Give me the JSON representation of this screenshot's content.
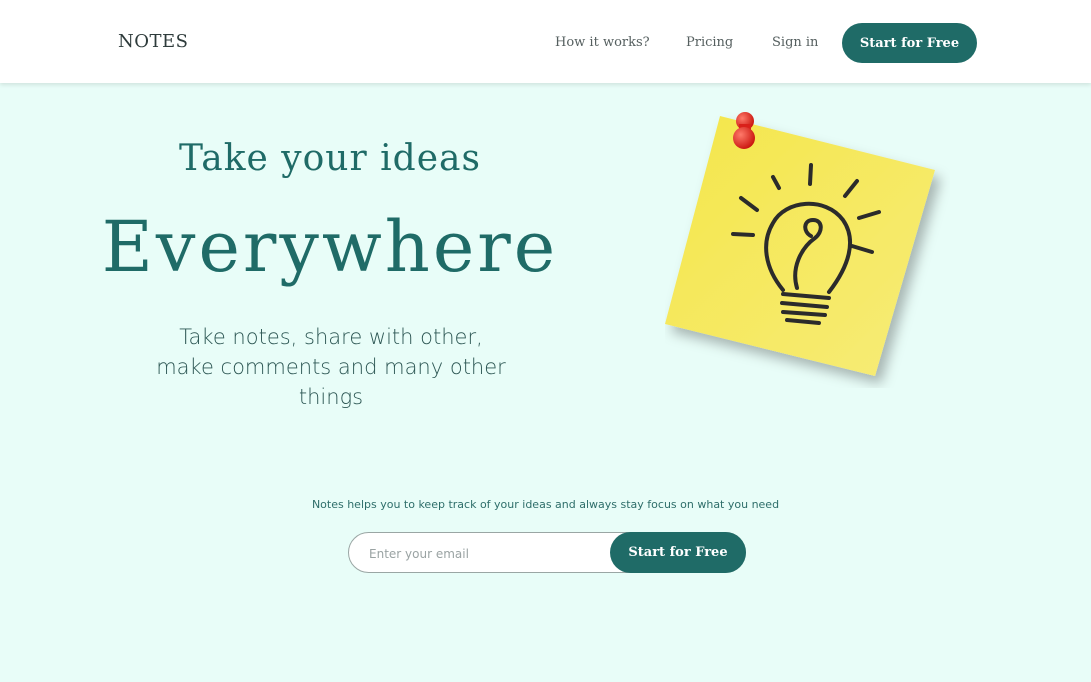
{
  "nav": {
    "logo": "NOTES",
    "links": [
      "How it works?",
      "Pricing",
      "Sign in"
    ],
    "cta_label": "Start for Free"
  },
  "hero": {
    "title": "Take your ideas",
    "headline": "Everywhere",
    "subtitle": "Take notes, share with other, make comments and many other things"
  },
  "illustration": {
    "icon": "lightbulb-sticky-note-icon",
    "note_color": "#f5e85a",
    "pin_color": "#e8231c"
  },
  "signup": {
    "tagline": "Notes helps you to keep track of your ideas and always stay focus on what you need",
    "email_placeholder": "Enter your email",
    "button_label": "Start for Free"
  },
  "colors": {
    "background": "#e8fdf8",
    "accent": "#1f6b67",
    "nav_bg": "#ffffff"
  }
}
